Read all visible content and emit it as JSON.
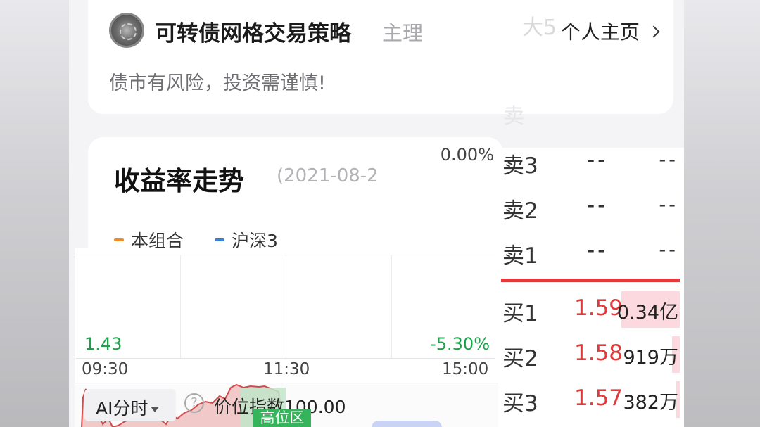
{
  "header": {
    "strategy_name": "可转债网格交易策略",
    "role": "主理",
    "homepage_link": "个人主页",
    "risk_note": "债市有风险，投资需谨慎!",
    "ghost_top": "大5",
    "ghost_mid": "卖"
  },
  "returns": {
    "title": "收益率走势",
    "date_partial": "(2021-08-2",
    "legend": [
      {
        "label": "本组合",
        "color": "#f08a24"
      },
      {
        "label": "沪深3",
        "color": "#3a7bd5"
      }
    ]
  },
  "intraday": {
    "pct_top": "0.00%",
    "price_low": "1.43",
    "pct_low": "-5.30%",
    "times": [
      "09:30",
      "11:30",
      "15:00"
    ],
    "ai_tab": "AI分时",
    "help_icon_text": "?",
    "price_index": "价位指数100.00",
    "high_zone": "高位区"
  },
  "orderbook": {
    "sell": [
      {
        "label": "卖3",
        "price": "--",
        "vol": "--"
      },
      {
        "label": "卖2",
        "price": "--",
        "vol": "--"
      },
      {
        "label": "卖1",
        "price": "--",
        "vol": "--"
      }
    ],
    "buy": [
      {
        "label": "买1",
        "price": "1.59",
        "vol": "0.34亿",
        "depth": 0.92
      },
      {
        "label": "买2",
        "price": "1.58",
        "vol": "919万",
        "depth": 0.12
      },
      {
        "label": "买3",
        "price": "1.57",
        "vol": "382万",
        "depth": 0.06
      }
    ],
    "colors": {
      "up": "#e23a3a",
      "divider": "#e23a3a",
      "bar": "#fbd9de"
    }
  }
}
